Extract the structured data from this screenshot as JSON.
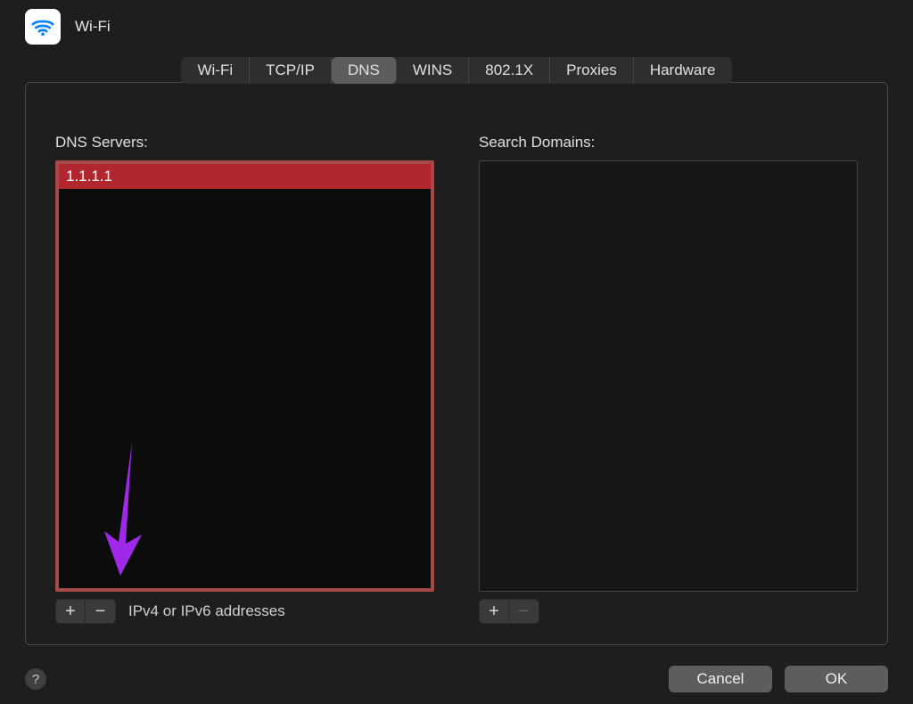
{
  "header": {
    "title": "Wi-Fi"
  },
  "tabs": [
    {
      "label": "Wi-Fi"
    },
    {
      "label": "TCP/IP"
    },
    {
      "label": "DNS",
      "active": true
    },
    {
      "label": "WINS"
    },
    {
      "label": "802.1X"
    },
    {
      "label": "Proxies"
    },
    {
      "label": "Hardware"
    }
  ],
  "dns": {
    "label": "DNS Servers:",
    "items": [
      "1.1.1.1"
    ],
    "hint": "IPv4 or IPv6 addresses",
    "plus": "+",
    "minus": "−"
  },
  "domains": {
    "label": "Search Domains:",
    "items": [],
    "plus": "+",
    "minus": "−"
  },
  "buttons": {
    "help": "?",
    "cancel": "Cancel",
    "ok": "OK"
  }
}
